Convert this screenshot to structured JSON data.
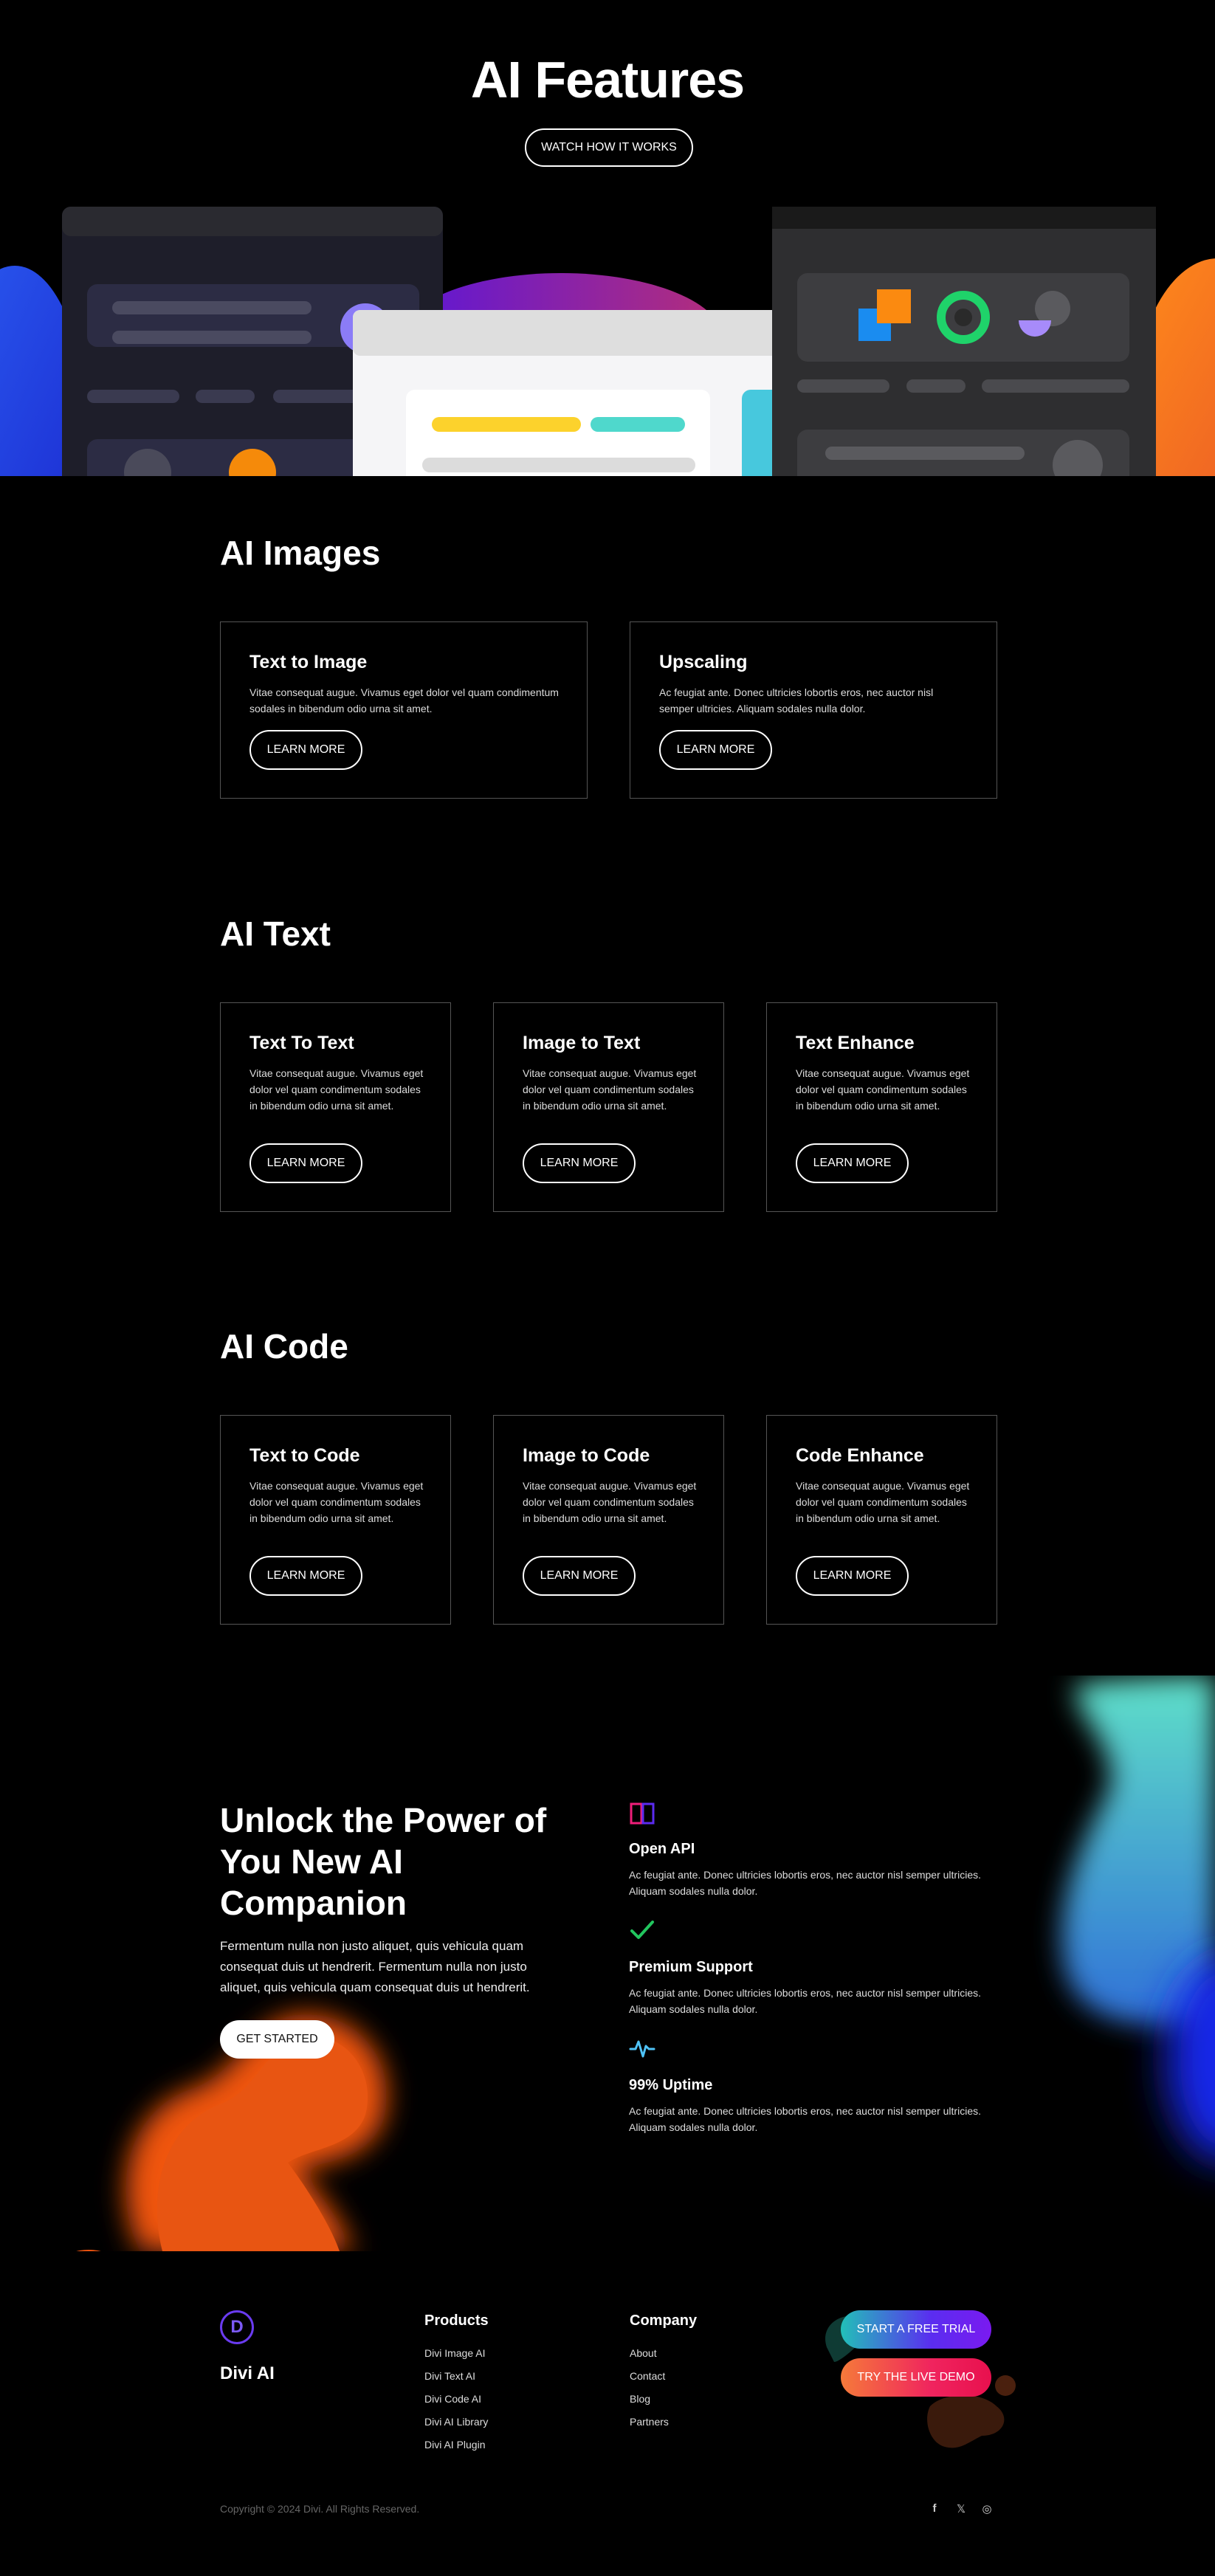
{
  "hero": {
    "title": "AI Features",
    "button": "WATCH HOW IT WORKS"
  },
  "images_section": {
    "title": "AI Images",
    "cards": [
      {
        "title": "Text to Image",
        "text": "Vitae consequat augue. Vivamus eget dolor vel quam condimentum sodales in bibendum odio urna sit amet.",
        "button": "LEARN MORE"
      },
      {
        "title": "Upscaling",
        "text": "Ac feugiat ante. Donec ultricies lobortis eros, nec auctor nisl semper ultricies. Aliquam sodales nulla dolor.",
        "button": "LEARN MORE"
      }
    ]
  },
  "text_section": {
    "title": "AI Text",
    "cards": [
      {
        "title": "Text To Text",
        "text": "Vitae consequat augue. Vivamus eget dolor vel quam condimentum sodales in bibendum odio urna sit amet.",
        "button": "LEARN MORE"
      },
      {
        "title": "Image to Text",
        "text": "Vitae consequat augue. Vivamus eget dolor vel quam condimentum sodales in bibendum odio urna sit amet.",
        "button": "LEARN MORE"
      },
      {
        "title": "Text Enhance",
        "text": "Vitae consequat augue. Vivamus eget dolor vel quam condimentum sodales in bibendum odio urna sit amet.",
        "button": "LEARN MORE"
      }
    ]
  },
  "code_section": {
    "title": "AI Code",
    "cards": [
      {
        "title": "Text to Code",
        "text": "Vitae consequat augue. Vivamus eget dolor vel quam condimentum sodales in bibendum odio urna sit amet.",
        "button": "LEARN MORE"
      },
      {
        "title": "Image to Code",
        "text": "Vitae consequat augue. Vivamus eget dolor vel quam condimentum sodales in bibendum odio urna sit amet.",
        "button": "LEARN MORE"
      },
      {
        "title": "Code Enhance",
        "text": "Vitae consequat augue. Vivamus eget dolor vel quam condimentum sodales in bibendum odio urna sit amet.",
        "button": "LEARN MORE"
      }
    ]
  },
  "unlock": {
    "title": "Unlock the Power of You New AI Companion",
    "text": "Fermentum nulla non justo aliquet, quis vehicula quam consequat duis ut hendrerit. Fermentum nulla non justo aliquet, quis vehicula quam consequat duis ut hendrerit.",
    "button": "GET STARTED",
    "features": [
      {
        "icon": "book-icon",
        "title": "Open API",
        "text": "Ac feugiat ante. Donec ultricies lobortis eros, nec auctor nisl semper ultricies. Aliquam sodales nulla dolor."
      },
      {
        "icon": "check-icon",
        "title": "Premium Support",
        "text": "Ac feugiat ante. Donec ultricies lobortis eros, nec auctor nisl semper ultricies. Aliquam sodales nulla dolor."
      },
      {
        "icon": "pulse-icon",
        "title": "99% Uptime",
        "text": "Ac feugiat ante. Donec ultricies lobortis eros, nec auctor nisl semper ultricies. Aliquam sodales nulla dolor."
      }
    ]
  },
  "footer": {
    "logo_letter": "D",
    "brand": "Divi AI",
    "products_heading": "Products",
    "products": [
      "Divi Image AI",
      "Divi Text AI",
      "Divi Code AI",
      "Divi AI Library",
      "Divi AI Plugin"
    ],
    "company_heading": "Company",
    "company": [
      "About",
      "Contact",
      "Blog",
      "Partners"
    ],
    "trial_button": "START A FREE TRIAL",
    "demo_button": "TRY THE LIVE DEMO",
    "copyright": "Copyright © 2024 Divi. All Rights Reserved.",
    "social": [
      "f",
      "𝕏",
      "◎"
    ]
  },
  "colors": {
    "orange": "#f25c1c",
    "teal": "#4fd1c5",
    "blue": "#1e3cf0",
    "yellow": "#fcd22c",
    "green": "#22c55e",
    "purple": "#7c3aed",
    "pink": "#ef1e7a"
  }
}
